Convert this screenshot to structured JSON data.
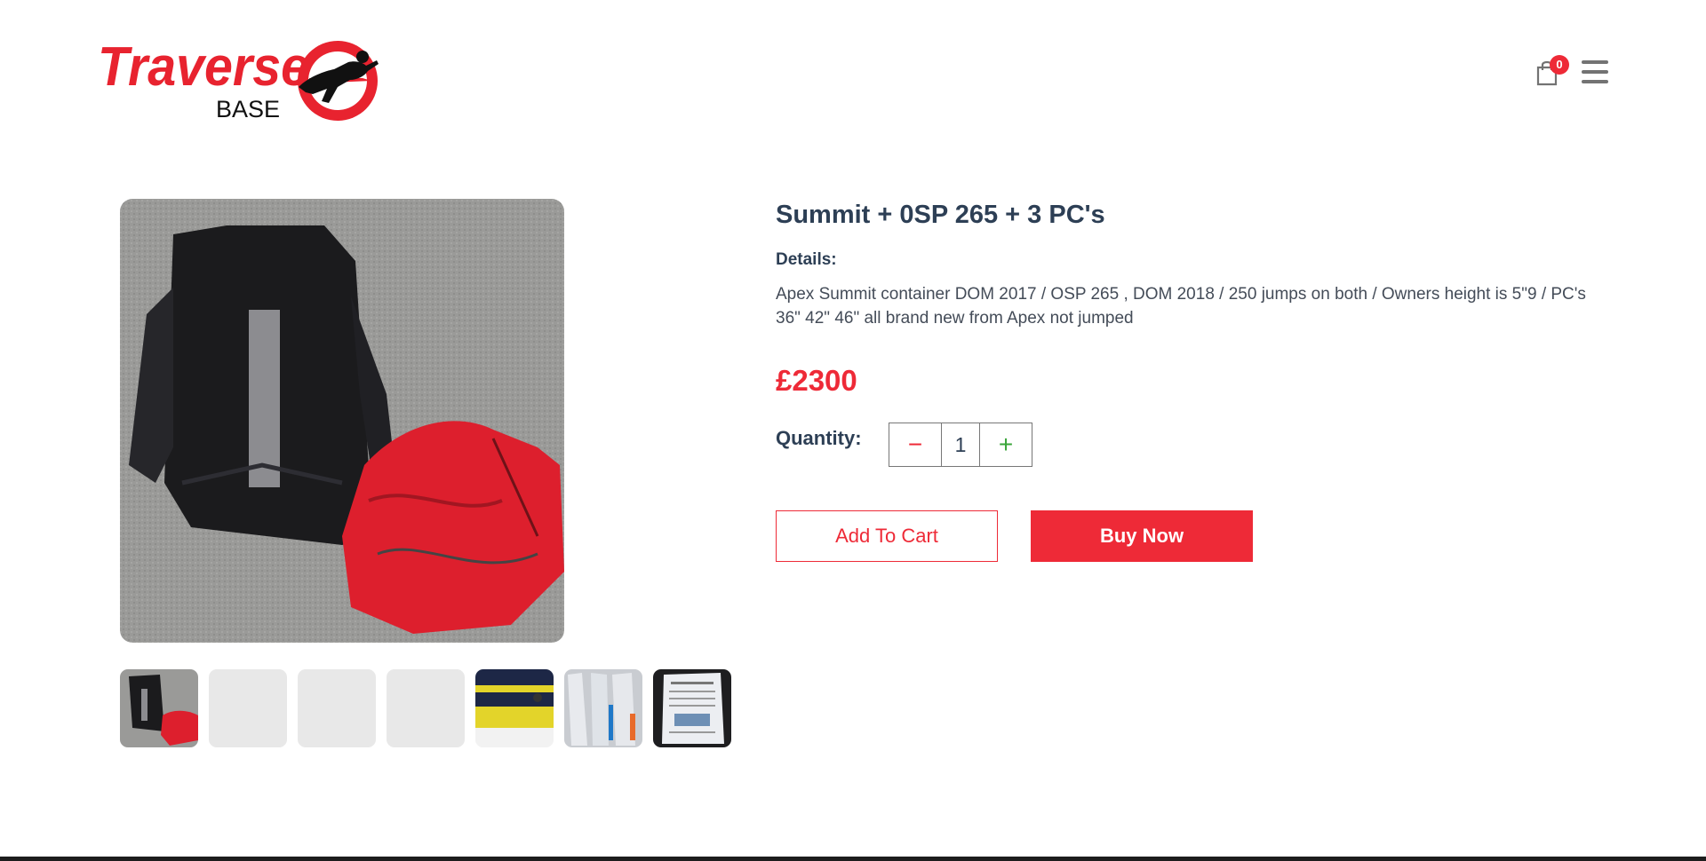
{
  "header": {
    "logo": {
      "text_main": "Traverse",
      "text_sub": "BASE",
      "icon": "skydiver-logo-icon"
    },
    "cart": {
      "icon": "shopping-bag-icon",
      "count": "0"
    },
    "menu": {
      "icon": "hamburger-menu-icon"
    }
  },
  "gallery": {
    "main_image": "black-container-with-red-canopy",
    "thumbnails": [
      {
        "state": "image",
        "label": "container-thumbnail"
      },
      {
        "state": "placeholder"
      },
      {
        "state": "placeholder"
      },
      {
        "state": "placeholder"
      },
      {
        "state": "image",
        "label": "yellow-bag-thumbnail"
      },
      {
        "state": "image",
        "label": "canopy-thumbnail"
      },
      {
        "state": "image",
        "label": "label-thumbnail"
      }
    ]
  },
  "product": {
    "title": "Summit + 0SP 265 + 3 PC's",
    "details_label": "Details:",
    "description": "Apex Summit container DOM 2017 / OSP 265 , DOM 2018 / 250 jumps on both / Owners height is 5\"9 / PC's 36\" 42\" 46\" all brand new from Apex not jumped",
    "price": "£2300",
    "quantity_label": "Quantity:",
    "quantity": "1",
    "minus_label": "−",
    "plus_label": "+"
  },
  "actions": {
    "add_to_cart": "Add To Cart",
    "buy_now": "Buy Now"
  },
  "colors": {
    "accent": "#ee2a37",
    "text": "#2d3f55",
    "plus": "#3aa53a"
  }
}
